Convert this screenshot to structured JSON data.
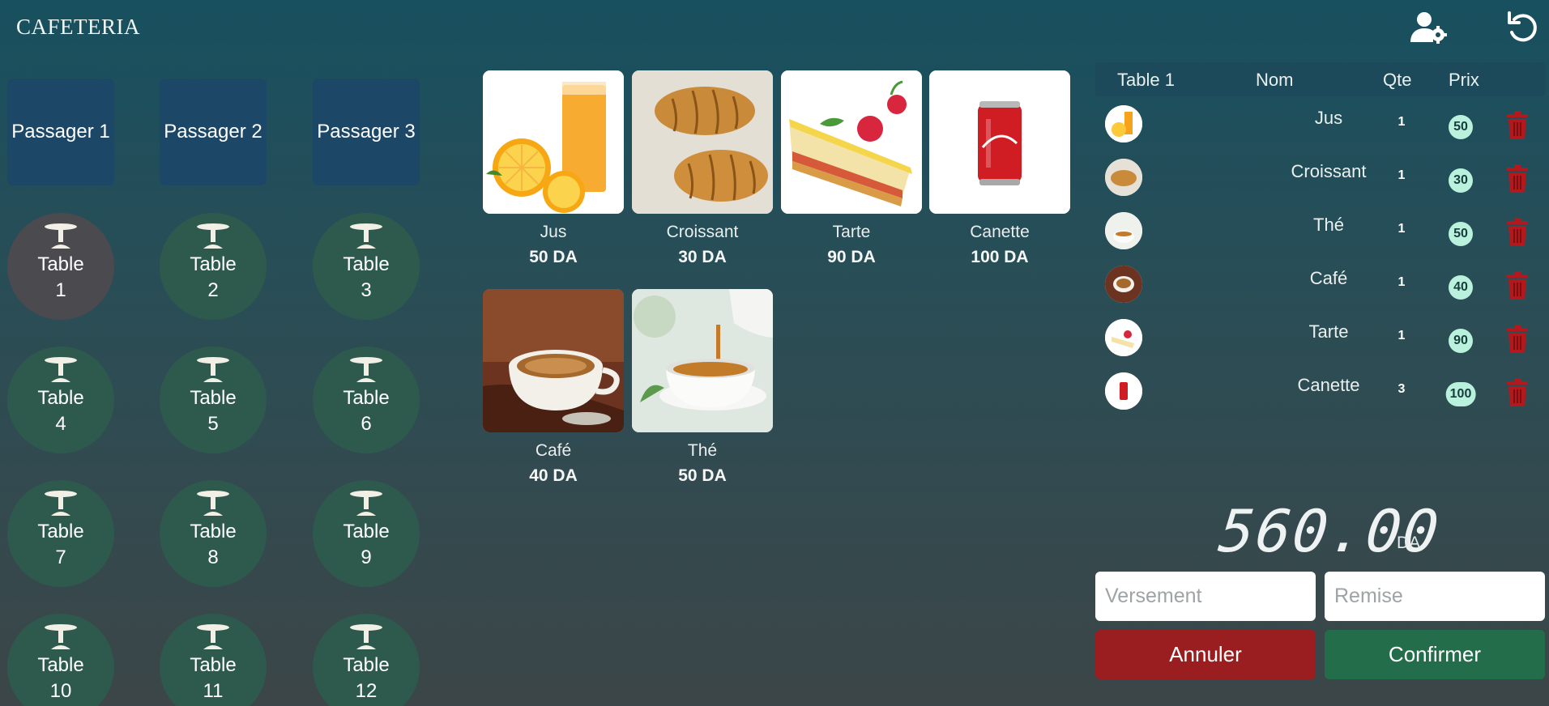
{
  "app": {
    "title": "CAFETERIA",
    "user_settings_icon": "user-gear-icon",
    "refresh_icon": "refresh-icon"
  },
  "passengers": [
    {
      "label": "Passager 1"
    },
    {
      "label": "Passager 2"
    },
    {
      "label": "Passager 3"
    }
  ],
  "tables": [
    {
      "label": "Table",
      "number": "1",
      "active": true
    },
    {
      "label": "Table",
      "number": "2"
    },
    {
      "label": "Table",
      "number": "3"
    },
    {
      "label": "Table",
      "number": "4"
    },
    {
      "label": "Table",
      "number": "5"
    },
    {
      "label": "Table",
      "number": "6"
    },
    {
      "label": "Table",
      "number": "7"
    },
    {
      "label": "Table",
      "number": "8"
    },
    {
      "label": "Table",
      "number": "9"
    },
    {
      "label": "Table",
      "number": "10"
    },
    {
      "label": "Table",
      "number": "11"
    },
    {
      "label": "Table",
      "number": "12"
    }
  ],
  "products": [
    {
      "name": "Jus",
      "price": "50 DA",
      "icon": "orange-juice-image"
    },
    {
      "name": "Croissant",
      "price": "30 DA",
      "icon": "croissant-image"
    },
    {
      "name": "Tarte",
      "price": "90 DA",
      "icon": "tart-image"
    },
    {
      "name": "Canette",
      "price": "100 DA",
      "icon": "soda-can-image"
    },
    {
      "name": "Café",
      "price": "40 DA",
      "icon": "coffee-image"
    },
    {
      "name": "Thé",
      "price": "50 DA",
      "icon": "tea-image"
    }
  ],
  "order": {
    "header": {
      "table": "Table 1",
      "name": "Nom",
      "qty": "Qte",
      "price": "Prix"
    },
    "items": [
      {
        "name": "Jus",
        "qty": "1",
        "price": "50"
      },
      {
        "name": "Croissant",
        "qty": "1",
        "price": "30"
      },
      {
        "name": "Thé",
        "qty": "1",
        "price": "50"
      },
      {
        "name": "Café",
        "qty": "1",
        "price": "40"
      },
      {
        "name": "Tarte",
        "qty": "1",
        "price": "90"
      },
      {
        "name": "Canette",
        "qty": "3",
        "price": "100"
      }
    ],
    "total": "560.00",
    "currency": "DA"
  },
  "payment": {
    "versement_placeholder": "Versement",
    "remise_placeholder": "Remise",
    "cancel_label": "Annuler",
    "confirm_label": "Confirmer"
  },
  "colors": {
    "passenger_bg": "#1c4766",
    "table_bg": "#2e5a4e",
    "table_active_bg": "#4a4a4f",
    "price_badge": "#b9f1dc",
    "delete_icon": "#b3181c",
    "cancel": "#9a1d1f",
    "confirm": "#246d4b"
  }
}
